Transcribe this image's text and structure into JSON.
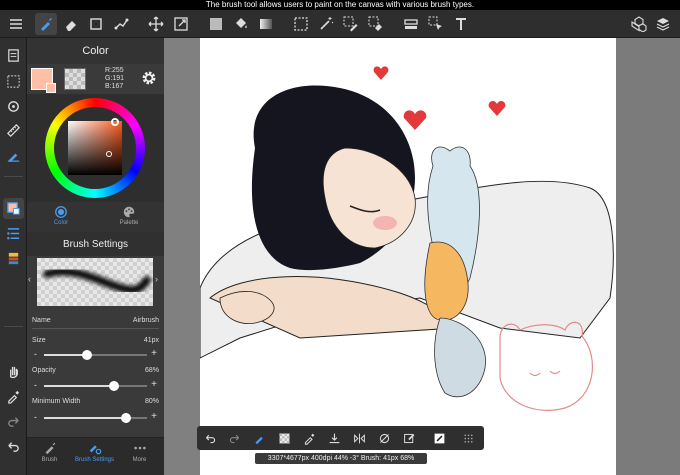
{
  "status": {
    "tooltip": "The brush tool allows users to paint on the canvas with various brush types."
  },
  "toolbar": {
    "tools": [
      "brush-icon",
      "eraser-icon",
      "rect-select-icon",
      "lasso-icon",
      "move-icon",
      "transform-icon",
      "fill-color-swatch",
      "bucket-icon",
      "gradient-icon",
      "marquee-icon",
      "magic-wand-icon",
      "select-pen-icon",
      "select-eraser-icon",
      "ruler-icon",
      "select-move-icon",
      "text-icon"
    ],
    "right_tools": [
      "materials-icon",
      "layers-icon"
    ]
  },
  "colors": {
    "accent": "#4a9cf0",
    "foreground": "#ffbfa7",
    "panel_bg": "#3a3a3a"
  },
  "color_panel": {
    "title": "Color",
    "rgb_r": "R:255",
    "rgb_g": "G:191",
    "rgb_b": "B:167",
    "tab_color": "Color",
    "tab_palette": "Palette"
  },
  "brush_settings": {
    "title": "Brush Settings",
    "name_label": "Name",
    "name_value": "Airbrush",
    "size_label": "Size",
    "size_value": "41px",
    "size_ratio": 0.42,
    "opacity_label": "Opacity",
    "opacity_value": "68%",
    "opacity_ratio": 0.68,
    "minwidth_label": "Minimum Width",
    "minwidth_value": "80%",
    "minwidth_ratio": 0.8
  },
  "panel_tabs": {
    "brush": "Brush",
    "brush_settings": "Brush Settings",
    "more": "More"
  },
  "canvas_info": "3307*4677px 400dpi 44% -3° Brush: 41px 68%"
}
